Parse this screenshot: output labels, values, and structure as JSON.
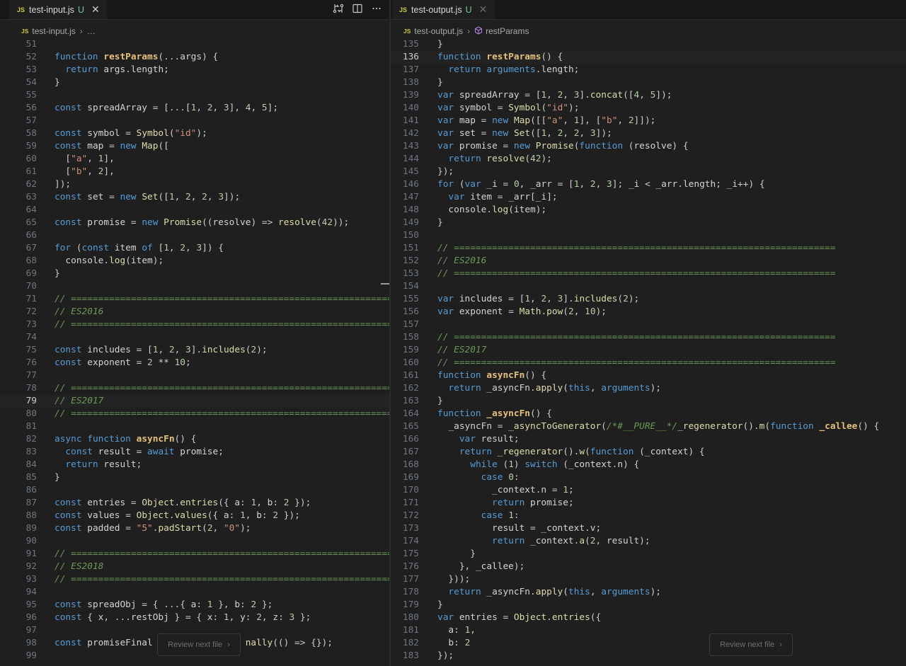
{
  "left_editor": {
    "tab": {
      "badge": "JS",
      "filename": "test-input.js",
      "status": "U",
      "close": "✕"
    },
    "breadcrumb": {
      "badge": "JS",
      "file": "test-input.js",
      "sep": "›",
      "rest": "…"
    },
    "current_line": "79",
    "lines": [
      {
        "n": "51",
        "t": ""
      },
      {
        "n": "52",
        "t": "function restParams(...args) {"
      },
      {
        "n": "53",
        "t": "  return args.length;"
      },
      {
        "n": "54",
        "t": "}"
      },
      {
        "n": "55",
        "t": ""
      },
      {
        "n": "56",
        "t": "const spreadArray = [...[1, 2, 3], 4, 5];"
      },
      {
        "n": "57",
        "t": ""
      },
      {
        "n": "58",
        "t": "const symbol = Symbol(\"id\");"
      },
      {
        "n": "59",
        "t": "const map = new Map(["
      },
      {
        "n": "60",
        "t": "  [\"a\", 1],"
      },
      {
        "n": "61",
        "t": "  [\"b\", 2],"
      },
      {
        "n": "62",
        "t": "]);"
      },
      {
        "n": "63",
        "t": "const set = new Set([1, 2, 2, 3]);"
      },
      {
        "n": "64",
        "t": ""
      },
      {
        "n": "65",
        "t": "const promise = new Promise((resolve) => resolve(42));"
      },
      {
        "n": "66",
        "t": ""
      },
      {
        "n": "67",
        "t": "for (const item of [1, 2, 3]) {"
      },
      {
        "n": "68",
        "t": "  console.log(item);"
      },
      {
        "n": "69",
        "t": "}"
      },
      {
        "n": "70",
        "t": ""
      },
      {
        "n": "71",
        "t": "// ======================================================================"
      },
      {
        "n": "72",
        "t": "// ES2016"
      },
      {
        "n": "73",
        "t": "// ======================================================================"
      },
      {
        "n": "74",
        "t": ""
      },
      {
        "n": "75",
        "t": "const includes = [1, 2, 3].includes(2);"
      },
      {
        "n": "76",
        "t": "const exponent = 2 ** 10;"
      },
      {
        "n": "77",
        "t": ""
      },
      {
        "n": "78",
        "t": "// ======================================================================"
      },
      {
        "n": "79",
        "t": "// ES2017"
      },
      {
        "n": "80",
        "t": "// ======================================================================"
      },
      {
        "n": "81",
        "t": ""
      },
      {
        "n": "82",
        "t": "async function asyncFn() {"
      },
      {
        "n": "83",
        "t": "  const result = await promise;"
      },
      {
        "n": "84",
        "t": "  return result;"
      },
      {
        "n": "85",
        "t": "}"
      },
      {
        "n": "86",
        "t": ""
      },
      {
        "n": "87",
        "t": "const entries = Object.entries({ a: 1, b: 2 });"
      },
      {
        "n": "88",
        "t": "const values = Object.values({ a: 1, b: 2 });"
      },
      {
        "n": "89",
        "t": "const padded = \"5\".padStart(2, \"0\");"
      },
      {
        "n": "90",
        "t": ""
      },
      {
        "n": "91",
        "t": "// ======================================================================"
      },
      {
        "n": "92",
        "t": "// ES2018"
      },
      {
        "n": "93",
        "t": "// ======================================================================"
      },
      {
        "n": "94",
        "t": ""
      },
      {
        "n": "95",
        "t": "const spreadObj = { ...{ a: 1 }, b: 2 };"
      },
      {
        "n": "96",
        "t": "const { x, ...restObj } = { x: 1, y: 2, z: 3 };"
      },
      {
        "n": "97",
        "t": ""
      },
      {
        "n": "98",
        "t": "const promiseFinal                 nally(() => {});"
      },
      {
        "n": "99",
        "t": ""
      }
    ],
    "review_button": {
      "label": "Review next file",
      "chevron": "›"
    }
  },
  "right_editor": {
    "tab": {
      "badge": "JS",
      "filename": "test-output.js",
      "status": "U",
      "close": "✕"
    },
    "breadcrumb": {
      "badge": "JS",
      "file": "test-output.js",
      "sep": "›",
      "symbol": "restParams"
    },
    "current_line": "136",
    "lines": [
      {
        "n": "135",
        "t": "}"
      },
      {
        "n": "136",
        "t": "function restParams() {"
      },
      {
        "n": "137",
        "t": "  return arguments.length;"
      },
      {
        "n": "138",
        "t": "}"
      },
      {
        "n": "139",
        "t": "var spreadArray = [1, 2, 3].concat([4, 5]);"
      },
      {
        "n": "140",
        "t": "var symbol = Symbol(\"id\");"
      },
      {
        "n": "141",
        "t": "var map = new Map([[\"a\", 1], [\"b\", 2]]);"
      },
      {
        "n": "142",
        "t": "var set = new Set([1, 2, 2, 3]);"
      },
      {
        "n": "143",
        "t": "var promise = new Promise(function (resolve) {"
      },
      {
        "n": "144",
        "t": "  return resolve(42);"
      },
      {
        "n": "145",
        "t": "});"
      },
      {
        "n": "146",
        "t": "for (var _i = 0, _arr = [1, 2, 3]; _i < _arr.length; _i++) {"
      },
      {
        "n": "147",
        "t": "  var item = _arr[_i];"
      },
      {
        "n": "148",
        "t": "  console.log(item);"
      },
      {
        "n": "149",
        "t": "}"
      },
      {
        "n": "150",
        "t": ""
      },
      {
        "n": "151",
        "t": "// ======================================================================"
      },
      {
        "n": "152",
        "t": "// ES2016"
      },
      {
        "n": "153",
        "t": "// ======================================================================"
      },
      {
        "n": "154",
        "t": ""
      },
      {
        "n": "155",
        "t": "var includes = [1, 2, 3].includes(2);"
      },
      {
        "n": "156",
        "t": "var exponent = Math.pow(2, 10);"
      },
      {
        "n": "157",
        "t": ""
      },
      {
        "n": "158",
        "t": "// ======================================================================"
      },
      {
        "n": "159",
        "t": "// ES2017"
      },
      {
        "n": "160",
        "t": "// ======================================================================"
      },
      {
        "n": "161",
        "t": "function asyncFn() {"
      },
      {
        "n": "162",
        "t": "  return _asyncFn.apply(this, arguments);"
      },
      {
        "n": "163",
        "t": "}"
      },
      {
        "n": "164",
        "t": "function _asyncFn() {"
      },
      {
        "n": "165",
        "t": "  _asyncFn = _asyncToGenerator(/*#__PURE__*/_regenerator().m(function _callee() {"
      },
      {
        "n": "166",
        "t": "    var result;"
      },
      {
        "n": "167",
        "t": "    return _regenerator().w(function (_context) {"
      },
      {
        "n": "168",
        "t": "      while (1) switch (_context.n) {"
      },
      {
        "n": "169",
        "t": "        case 0:"
      },
      {
        "n": "170",
        "t": "          _context.n = 1;"
      },
      {
        "n": "171",
        "t": "          return promise;"
      },
      {
        "n": "172",
        "t": "        case 1:"
      },
      {
        "n": "173",
        "t": "          result = _context.v;"
      },
      {
        "n": "174",
        "t": "          return _context.a(2, result);"
      },
      {
        "n": "175",
        "t": "      }"
      },
      {
        "n": "176",
        "t": "    }, _callee);"
      },
      {
        "n": "177",
        "t": "  }));"
      },
      {
        "n": "178",
        "t": "  return _asyncFn.apply(this, arguments);"
      },
      {
        "n": "179",
        "t": "}"
      },
      {
        "n": "180",
        "t": "var entries = Object.entries({"
      },
      {
        "n": "181",
        "t": "  a: 1,"
      },
      {
        "n": "182",
        "t": "  b: 2"
      },
      {
        "n": "183",
        "t": "});"
      }
    ],
    "review_button": {
      "label": "Review next file",
      "chevron": "›"
    }
  },
  "icons": {
    "compare": "compare-changes-icon",
    "split": "split-editor-icon",
    "more": "more-actions-icon"
  },
  "colors": {
    "background": "#1f1f1f",
    "keyword": "#569cd6",
    "function": "#dcdcaa",
    "comment": "#6a9955",
    "string": "#ce9178",
    "number": "#b5cea8",
    "untracked": "#73c991"
  }
}
